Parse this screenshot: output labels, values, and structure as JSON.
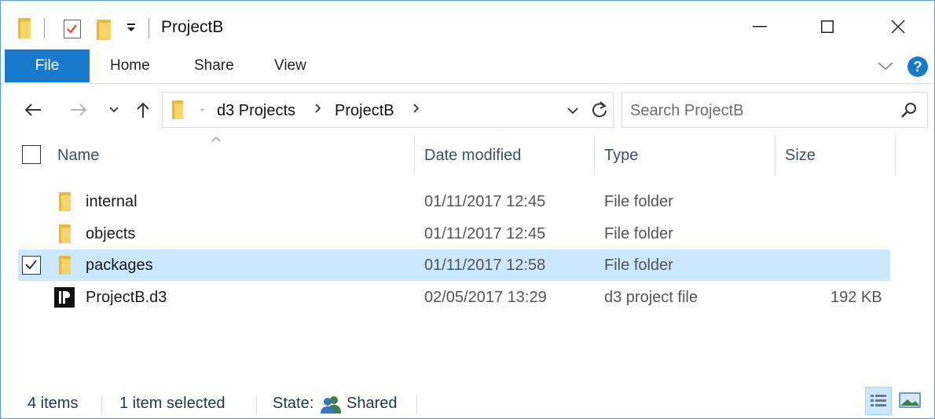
{
  "window": {
    "title": "ProjectB",
    "controls": {
      "minimize": "—",
      "maximize": "☐",
      "close": "✕"
    }
  },
  "ribbon": {
    "tabs": [
      "File",
      "Home",
      "Share",
      "View"
    ],
    "help": "?"
  },
  "nav": {
    "breadcrumb": [
      "d3 Projects",
      "ProjectB"
    ],
    "search_placeholder": "Search ProjectB"
  },
  "columns": {
    "name": "Name",
    "date": "Date modified",
    "type": "Type",
    "size": "Size"
  },
  "files": [
    {
      "name": "internal",
      "date": "01/11/2017 12:45",
      "type": "File folder",
      "size": "",
      "icon": "folder-icon",
      "selected": false
    },
    {
      "name": "objects",
      "date": "01/11/2017 12:45",
      "type": "File folder",
      "size": "",
      "icon": "folder-icon",
      "selected": false
    },
    {
      "name": "packages",
      "date": "01/11/2017 12:58",
      "type": "File folder",
      "size": "",
      "icon": "folder-icon",
      "selected": true
    },
    {
      "name": "ProjectB.d3",
      "date": "02/05/2017 13:29",
      "type": "d3 project file",
      "size": "192 KB",
      "icon": "d3-file-icon",
      "selected": false
    }
  ],
  "status": {
    "items": "4 items",
    "selected": "1 item selected",
    "state_label": "State:",
    "state_value": "Shared"
  },
  "colors": {
    "accent": "#1979ca",
    "selection": "#cce8ff",
    "folder": "#f7d46a"
  }
}
